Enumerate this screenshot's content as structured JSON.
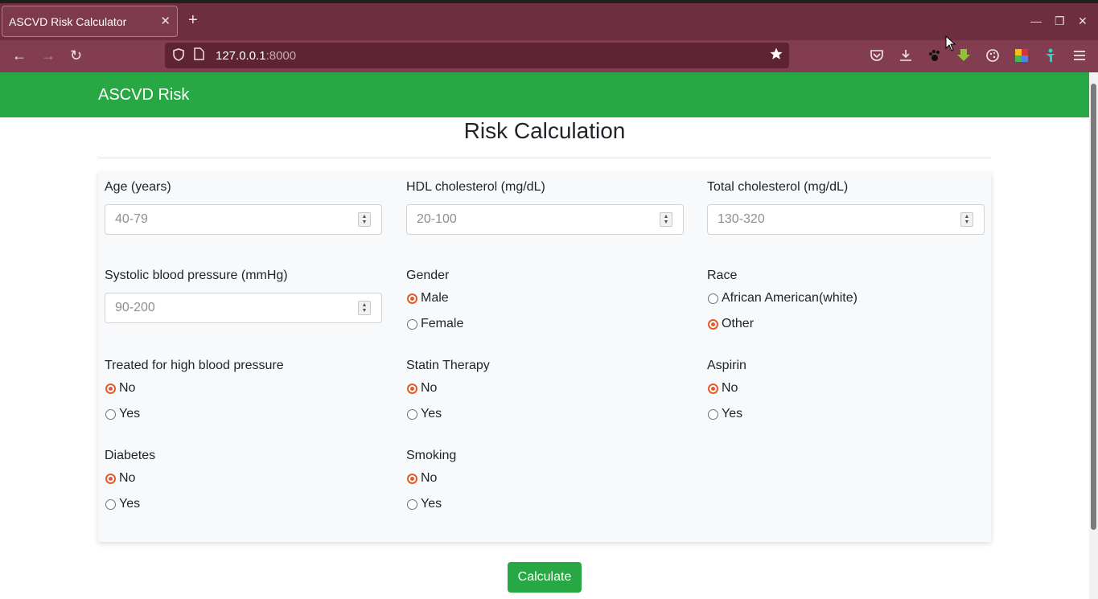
{
  "browser": {
    "tab_title": "ASCVD Risk Calculator",
    "tab_close": "✕",
    "new_tab": "+",
    "window_controls": {
      "minimize": "—",
      "restore": "❐",
      "close": "✕"
    },
    "nav": {
      "back": "←",
      "forward": "→",
      "reload": "↻"
    },
    "url_host": "127.0.0.1",
    "url_port": ":8000",
    "icons": [
      "shield-icon",
      "page-icon",
      "bookmark-star-icon",
      "pocket-icon",
      "download-icon",
      "extension-paw-icon",
      "extension-arrow-icon",
      "extension-cookie-icon",
      "extension-color-icon",
      "extension-figure-icon",
      "menu-icon"
    ]
  },
  "app": {
    "brand": "ASCVD Risk",
    "page_title": "Risk Calculation",
    "accent_color": "#28a745",
    "radio_color": "#e55a2b"
  },
  "form": {
    "age": {
      "label": "Age (years)",
      "placeholder": "40-79",
      "value": ""
    },
    "hdl": {
      "label": "HDL cholesterol (mg/dL)",
      "placeholder": "20-100",
      "value": ""
    },
    "total_chol": {
      "label": "Total cholesterol (mg/dL)",
      "placeholder": "130-320",
      "value": ""
    },
    "sbp": {
      "label": "Systolic blood pressure (mmHg)",
      "placeholder": "90-200",
      "value": ""
    },
    "gender": {
      "label": "Gender",
      "options": [
        "Male",
        "Female"
      ],
      "selected": "Male"
    },
    "race": {
      "label": "Race",
      "options": [
        "African American(white)",
        "Other"
      ],
      "selected": "Other"
    },
    "treated_bp": {
      "label": "Treated for high blood pressure",
      "options": [
        "No",
        "Yes"
      ],
      "selected": "No"
    },
    "statin": {
      "label": "Statin Therapy",
      "options": [
        "No",
        "Yes"
      ],
      "selected": "No"
    },
    "aspirin": {
      "label": "Aspirin",
      "options": [
        "No",
        "Yes"
      ],
      "selected": "No"
    },
    "diabetes": {
      "label": "Diabetes",
      "options": [
        "No",
        "Yes"
      ],
      "selected": "No"
    },
    "smoking": {
      "label": "Smoking",
      "options": [
        "No",
        "Yes"
      ],
      "selected": "No"
    },
    "submit_label": "Calculate"
  }
}
